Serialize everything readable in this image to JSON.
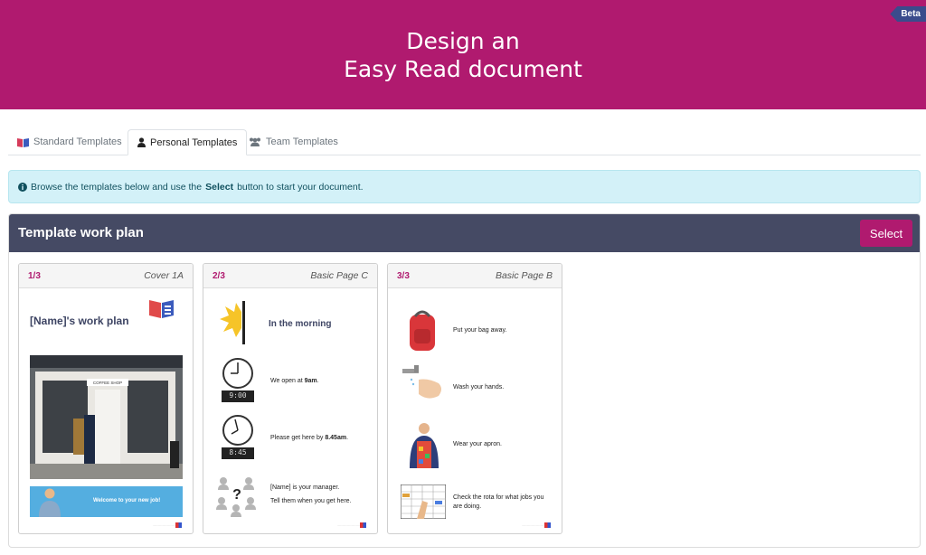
{
  "header": {
    "title_line1": "Design an",
    "title_line2": "Easy Read document",
    "badge": "Beta",
    "bg_color": "#b01a6f"
  },
  "tabs": [
    {
      "label": "Standard Templates",
      "icon": "book-icon",
      "active": false
    },
    {
      "label": "Personal Templates",
      "icon": "user-icon",
      "active": true
    },
    {
      "label": "Team Templates",
      "icon": "users-icon",
      "active": false
    }
  ],
  "info": {
    "icon": "info-circle-icon",
    "text_before": "Browse the templates below and use the",
    "bold": "Select",
    "text_after": "button to start your document."
  },
  "template": {
    "title": "Template work plan",
    "select_label": "Select",
    "accent_color": "#b01a6f",
    "header_color": "#454a64"
  },
  "pages": [
    {
      "num": "1/3",
      "label": "Cover 1A",
      "title": "[Name]'s work plan",
      "shop_sign": "COFFEE SHOP",
      "banner": "Welcome to your new job!"
    },
    {
      "num": "2/3",
      "label": "Basic Page C",
      "heading": "In the morning",
      "rows": [
        {
          "before": "We open at ",
          "bold": "9am",
          "after": ".",
          "clock": "9:00"
        },
        {
          "before": "Please get here by ",
          "bold": "8.45am",
          "after": ".",
          "clock": "8:45"
        }
      ],
      "manager_line1": "[Name] is your manager.",
      "manager_line2": "Tell them when you get here."
    },
    {
      "num": "3/3",
      "label": "Basic Page B",
      "rows": [
        "Put your bag away.",
        "Wash your hands.",
        "Wear your apron.",
        "Check the rota for what jobs you are doing."
      ]
    }
  ]
}
